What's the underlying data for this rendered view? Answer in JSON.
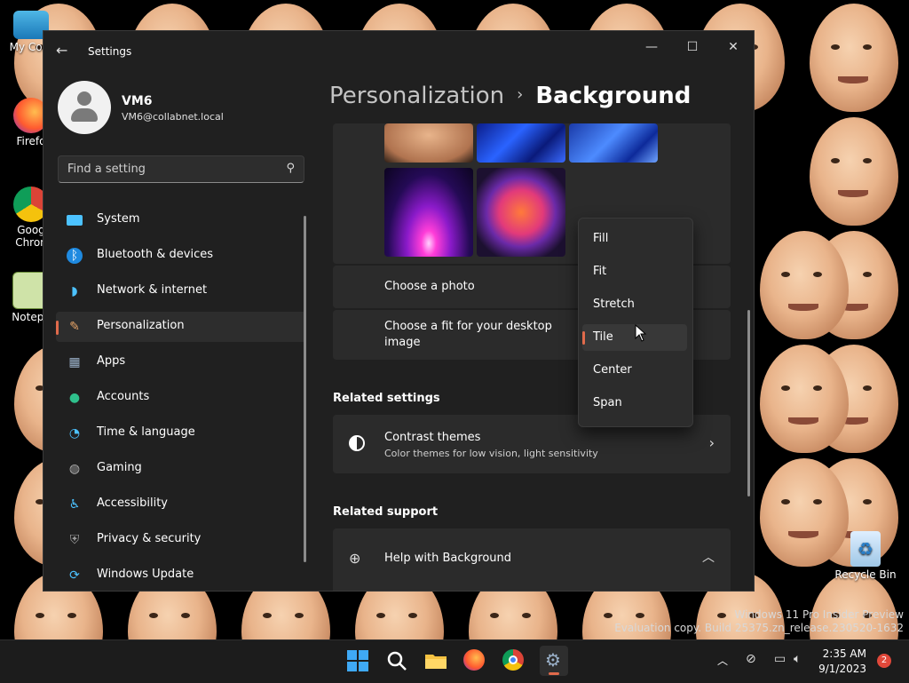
{
  "desktop": {
    "icons": [
      {
        "label": "My Com",
        "name": "my-computer"
      },
      {
        "label": "Firefo",
        "name": "firefox"
      },
      {
        "label": "Goog Chron",
        "name": "google-chrome"
      },
      {
        "label": "Notepa",
        "name": "notepad"
      },
      {
        "label": "Recycle Bin",
        "name": "recycle-bin"
      }
    ],
    "watermark_line1": "Windows 11 Pro Insider Preview",
    "watermark_line2": "Evaluation copy. Build 25375.zn_release.230520-1632"
  },
  "window": {
    "title": "Settings",
    "controls": {
      "minimize": "—",
      "maximize": "☐",
      "close": "✕"
    }
  },
  "profile": {
    "name": "VM6",
    "email": "VM6@collabnet.local"
  },
  "search": {
    "placeholder": "Find a setting"
  },
  "nav": [
    {
      "label": "System",
      "icon": "monitor-icon",
      "color": "#4cc2ff"
    },
    {
      "label": "Bluetooth & devices",
      "icon": "bluetooth-icon",
      "color": "#4cc2ff"
    },
    {
      "label": "Network & internet",
      "icon": "wifi-icon",
      "color": "#4cc2ff"
    },
    {
      "label": "Personalization",
      "icon": "brush-icon",
      "color": "#e7a568"
    },
    {
      "label": "Apps",
      "icon": "apps-icon",
      "color": "#9ab0c8"
    },
    {
      "label": "Accounts",
      "icon": "person-icon",
      "color": "#2fc08c"
    },
    {
      "label": "Time & language",
      "icon": "globe-clock-icon",
      "color": "#4cc2ff"
    },
    {
      "label": "Gaming",
      "icon": "gamepad-icon",
      "color": "#b0b0b0"
    },
    {
      "label": "Accessibility",
      "icon": "accessibility-icon",
      "color": "#4cc2ff"
    },
    {
      "label": "Privacy & security",
      "icon": "shield-icon",
      "color": "#a0a0a0"
    },
    {
      "label": "Windows Update",
      "icon": "update-icon",
      "color": "#4cc2ff"
    }
  ],
  "active_nav": "Personalization",
  "breadcrumb": {
    "parent": "Personalization",
    "separator": "›",
    "current": "Background"
  },
  "background_settings": {
    "choose_photo_label": "Choose a photo",
    "choose_fit_label_1": "Choose a fit for your desktop",
    "choose_fit_label_2": "image"
  },
  "fit_dropdown": {
    "options": [
      "Fill",
      "Fit",
      "Stretch",
      "Tile",
      "Center",
      "Span"
    ],
    "selected": "Tile"
  },
  "related_settings": {
    "title": "Related settings",
    "contrast_title": "Contrast themes",
    "contrast_desc": "Color themes for low vision, light sensitivity"
  },
  "related_support": {
    "title": "Related support",
    "help_label": "Help with Background"
  },
  "taskbar": {
    "time": "2:35 AM",
    "date": "9/1/2023",
    "notifications": "2"
  },
  "colors": {
    "accent": "#e06a4b",
    "window_bg": "#202020",
    "card_bg": "#2b2b2b"
  }
}
